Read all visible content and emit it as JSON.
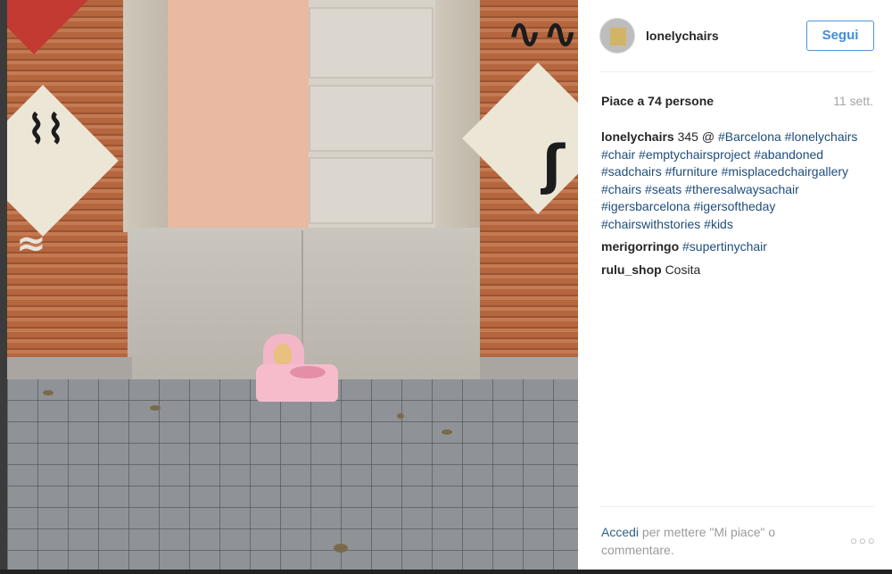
{
  "post": {
    "photo_alt": "",
    "header": {
      "username": "lonelychairs",
      "follow_label": "Segui"
    },
    "likes_text": "Piace a 74 persone",
    "timestamp": "11 sett.",
    "caption": {
      "username": "lonelychairs",
      "text_prefix": "345 @",
      "hashtags": [
        "#Barcelona",
        "#lonelychairs",
        "#chair",
        "#emptychairsproject",
        "#abandoned",
        "#sadchairs",
        "#furniture",
        "#misplacedchairgallery",
        "#chairs",
        "#seats",
        "#theresalwaysachair",
        "#igersbarcelona",
        "#igersoftheday",
        "#chairswithstories",
        "#kids"
      ]
    },
    "comments": [
      {
        "username": "merigorringo",
        "text": "#supertinychair",
        "is_hashtag": true
      },
      {
        "username": "rulu_shop",
        "text": "Cosita",
        "is_hashtag": false
      }
    ],
    "login_prompt": {
      "link": "Accedi",
      "text": "per mettere \"Mi piace\" o commentare."
    },
    "more_icon": "ellipsis-icon",
    "more_glyph": "○○○"
  },
  "colors": {
    "follow_border": "#4c95d8",
    "hashtag": "#1f4d7a",
    "muted": "#9b9b9b"
  }
}
